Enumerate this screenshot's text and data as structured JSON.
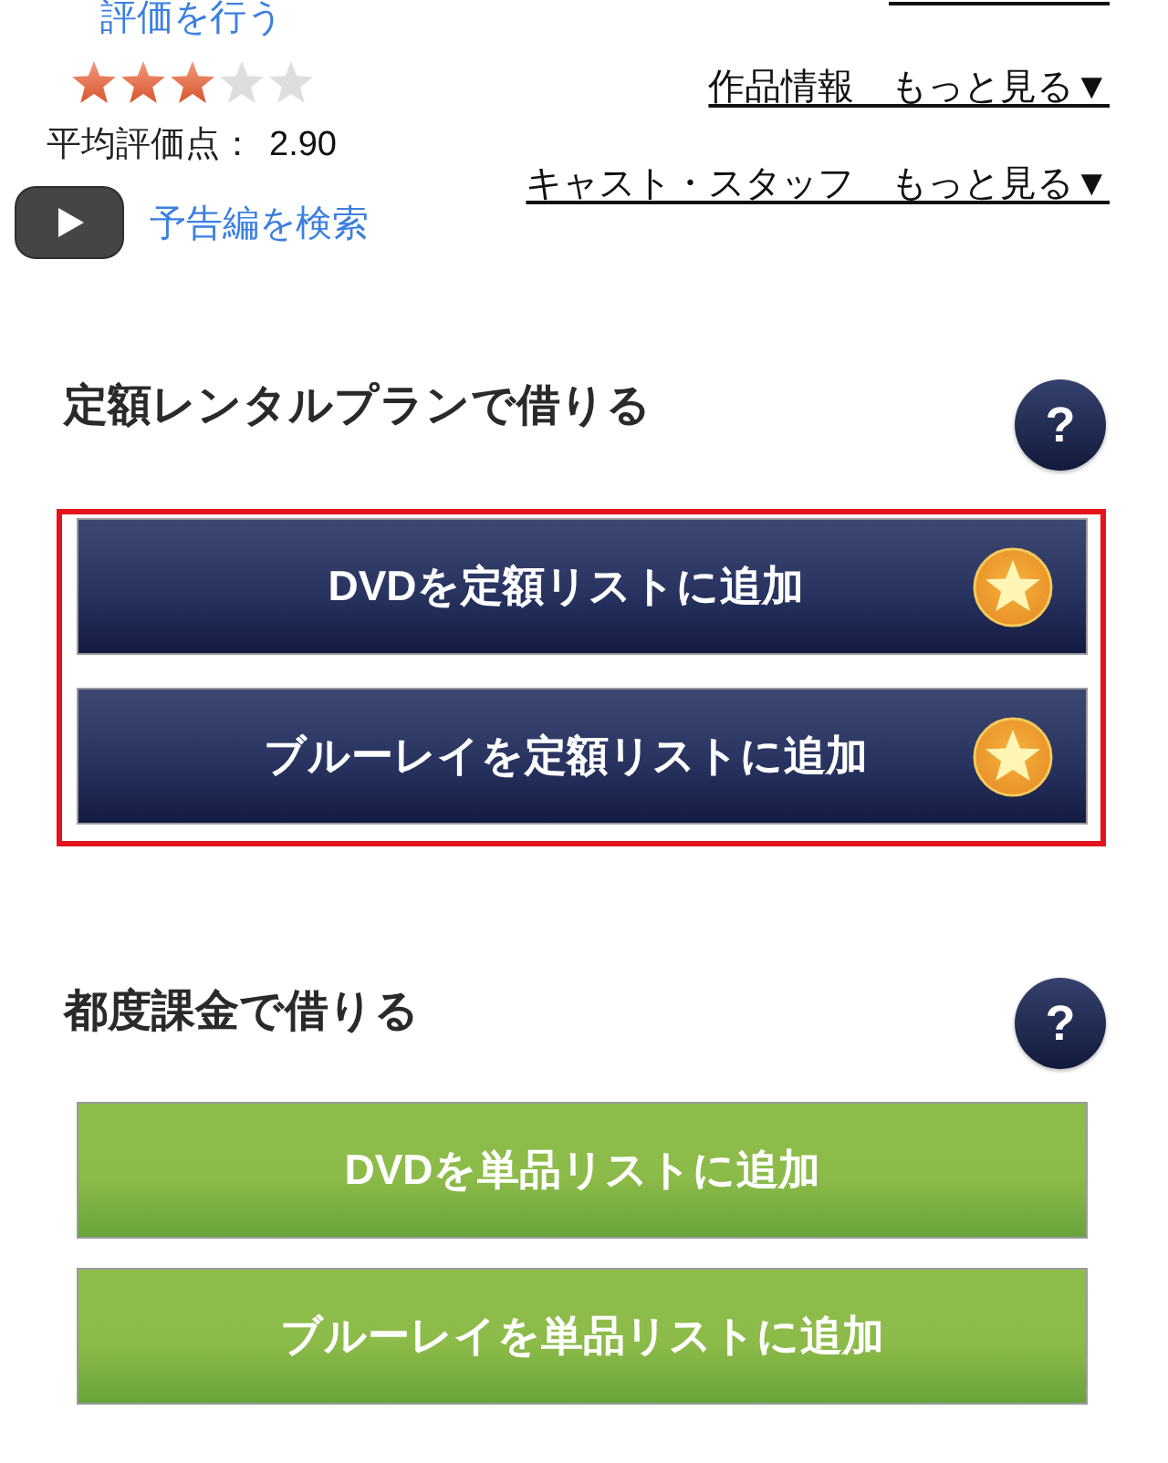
{
  "rating": {
    "rate_link": "評価を行う",
    "stars": 3,
    "average_label": "平均評価点：",
    "average_value": "2.90"
  },
  "trailer": {
    "link": "予告編を検索"
  },
  "more_links": [
    {
      "label": "作品情報　もっと見る▼"
    },
    {
      "label": "キャスト・スタッフ　もっと見る▼"
    }
  ],
  "sections": [
    {
      "title": "定額レンタルプランで借りる",
      "help": "?",
      "kind": "fixed_plan",
      "highlighted": true,
      "buttons": [
        {
          "label": "DVDを定額リストに追加"
        },
        {
          "label": "ブルーレイを定額リストに追加"
        }
      ]
    },
    {
      "title": "都度課金で借りる",
      "help": "?",
      "kind": "per_item",
      "highlighted": false,
      "buttons": [
        {
          "label": "DVDを単品リストに追加"
        },
        {
          "label": "ブルーレイを単品リストに追加"
        }
      ]
    }
  ]
}
